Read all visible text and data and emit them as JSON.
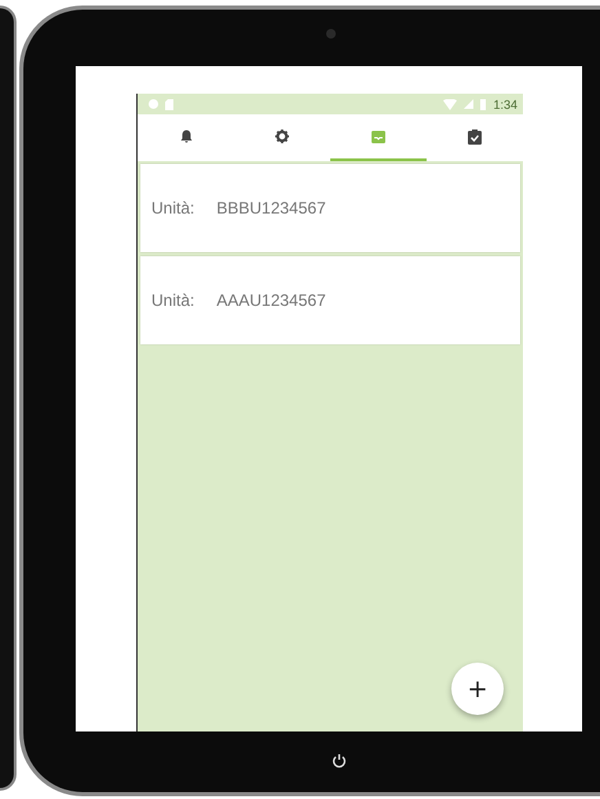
{
  "status_bar": {
    "time": "1:34"
  },
  "tabs": [
    {
      "kind": "bell",
      "selected": false
    },
    {
      "kind": "gear",
      "selected": false
    },
    {
      "kind": "inbox",
      "selected": true
    },
    {
      "kind": "checklist",
      "selected": false
    }
  ],
  "cards": [
    {
      "label": "Unità:",
      "value": "BBBU1234567"
    },
    {
      "label": "Unità:",
      "value": "AAAU1234567"
    }
  ],
  "fab": {
    "label": "+"
  }
}
